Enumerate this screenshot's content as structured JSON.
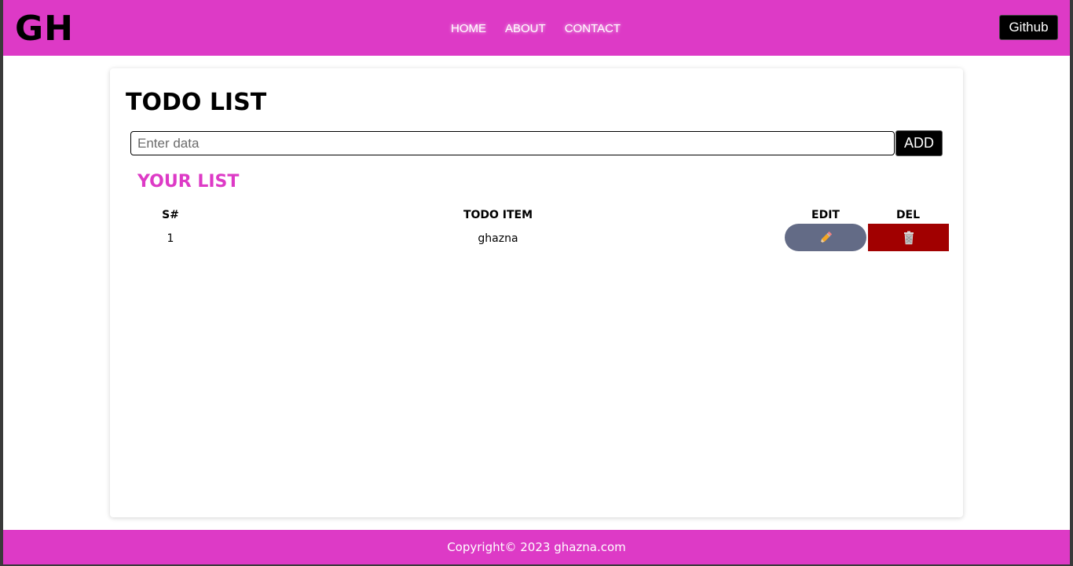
{
  "navbar": {
    "logo": "GH",
    "links": [
      {
        "label": "HOME"
      },
      {
        "label": "ABOUT"
      },
      {
        "label": "CONTACT"
      }
    ],
    "github_label": "Github"
  },
  "card": {
    "title": "TODO LIST",
    "input": {
      "value": "",
      "placeholder": "Enter data"
    },
    "add_label": "ADD",
    "list_title": "YOUR LIST",
    "table": {
      "headers": {
        "serial": "S#",
        "item": "TODO ITEM",
        "edit": "EDIT",
        "del": "DEL"
      },
      "rows": [
        {
          "serial": "1",
          "item": "ghazna",
          "edit_icon": "pencil-icon",
          "del_icon": "trash-icon"
        }
      ]
    }
  },
  "footer": {
    "text": "Copyright© 2023 ghazna.com"
  },
  "colors": {
    "brand": "#dd3ac6",
    "edit_button": "#636b86",
    "delete_button": "#a10000"
  }
}
